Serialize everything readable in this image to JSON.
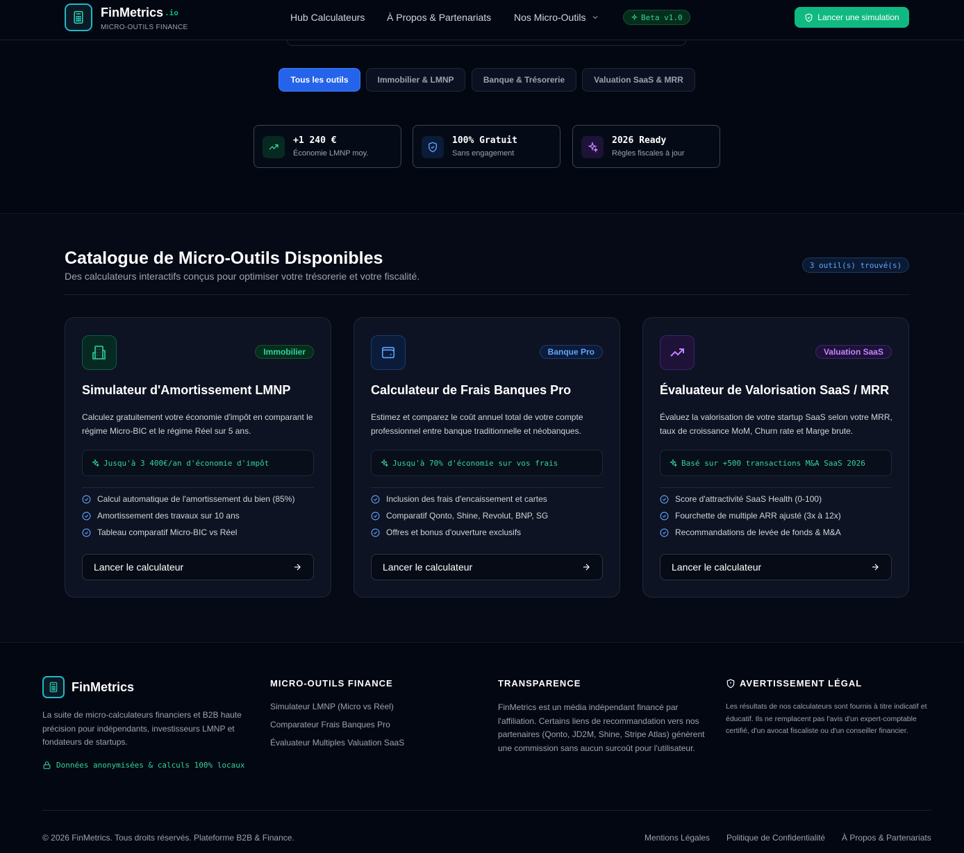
{
  "header": {
    "brand": "FinMetrics",
    "brand_suffix": ".io",
    "brand_tagline": "MICRO-OUTILS FINANCE",
    "nav": [
      "Hub Calculateurs",
      "À Propos & Partenariats",
      "Nos Micro-Outils"
    ],
    "beta_badge": "Beta v1.0",
    "cta_label": "Lancer une simulation"
  },
  "filters": [
    "Tous les outils",
    "Immobilier & LMNP",
    "Banque & Trésorerie",
    "Valuation SaaS & MRR"
  ],
  "active_filter": "Tous les outils",
  "stats": [
    {
      "value": "+1 240 €",
      "label": "Économie LMNP moy.",
      "icon": "trending-up-icon"
    },
    {
      "value": "100% Gratuit",
      "label": "Sans engagement",
      "icon": "shield-check-icon"
    },
    {
      "value": "2026 Ready",
      "label": "Règles fiscales à jour",
      "icon": "sparkles-icon"
    }
  ],
  "catalog": {
    "title": "Catalogue de Micro-Outils Disponibles",
    "subtitle": "Des calculateurs interactifs conçus pour optimiser votre trésorerie et votre fiscalité.",
    "count_badge": "3 outil(s) trouvé(s)"
  },
  "cards": [
    {
      "badge": "Immobilier",
      "title": "Simulateur d'Amortissement LMNP",
      "description": "Calculez gratuitement votre économie d'impôt en comparant le régime Micro-BIC et le régime Réel sur 5 ans.",
      "highlight": "Jusqu'à 3 400€/an d'économie d'impôt",
      "features": [
        "Calcul automatique de l'amortissement du bien (85%)",
        "Amortissement des travaux sur 10 ans",
        "Tableau comparatif Micro-BIC vs Réel"
      ],
      "button": "Lancer le calculateur",
      "icon": "building-icon",
      "accent": "#10b981"
    },
    {
      "badge": "Banque Pro",
      "title": "Calculateur de Frais Banques Pro",
      "description": "Estimez et comparez le coût annuel total de votre compte professionnel entre banque traditionnelle et néobanques.",
      "highlight": "Jusqu'à 70% d'économie sur vos frais",
      "features": [
        "Inclusion des frais d'encaissement et cartes",
        "Comparatif Qonto, Shine, Revolut, BNP, SG",
        "Offres et bonus d'ouverture exclusifs"
      ],
      "button": "Lancer le calculateur",
      "icon": "wallet-icon",
      "accent": "#3b82f6"
    },
    {
      "badge": "Valuation SaaS",
      "title": "Évaluateur de Valorisation SaaS / MRR",
      "description": "Évaluez la valorisation de votre startup SaaS selon votre MRR, taux de croissance MoM, Churn rate et Marge brute.",
      "highlight": "Basé sur +500 transactions M&A SaaS 2026",
      "features": [
        "Score d'attractivité SaaS Health (0-100)",
        "Fourchette de multiple ARR ajusté (3x à 12x)",
        "Recommandations de levée de fonds & M&A"
      ],
      "button": "Lancer le calculateur",
      "icon": "trending-up-icon",
      "accent": "#a855f7"
    }
  ],
  "footer": {
    "brand": "FinMetrics",
    "about": "La suite de micro-calculateurs financiers et B2B haute précision pour indépendants, investisseurs LMNP et fondateurs de startups.",
    "secure_note": "Données anonymisées & calculs 100% locaux",
    "tools_heading": "MICRO-OUTILS FINANCE",
    "tools_links": [
      "Simulateur LMNP (Micro vs Réel)",
      "Comparateur Frais Banques Pro",
      "Évaluateur Multiples Valuation SaaS"
    ],
    "transparency_heading": "TRANSPARENCE",
    "transparency_text": "FinMetrics est un média indépendant financé par l'affiliation. Certains liens de recommandation vers nos partenaires (Qonto, JD2M, Shine, Stripe Atlas) génèrent une commission sans aucun surcoût pour l'utilisateur.",
    "legal_heading": "AVERTISSEMENT LÉGAL",
    "legal_text": "Les résultats de nos calculateurs sont fournis à titre indicatif et éducatif. Ils ne remplacent pas l'avis d'un expert-comptable certifié, d'un avocat fiscaliste ou d'un conseiller financier.",
    "copyright": "© 2026 FinMetrics. Tous droits réservés. Plateforme B2B & Finance.",
    "bottom_links": [
      "Mentions Légales",
      "Politique de Confidentialité",
      "À Propos & Partenariats"
    ]
  }
}
